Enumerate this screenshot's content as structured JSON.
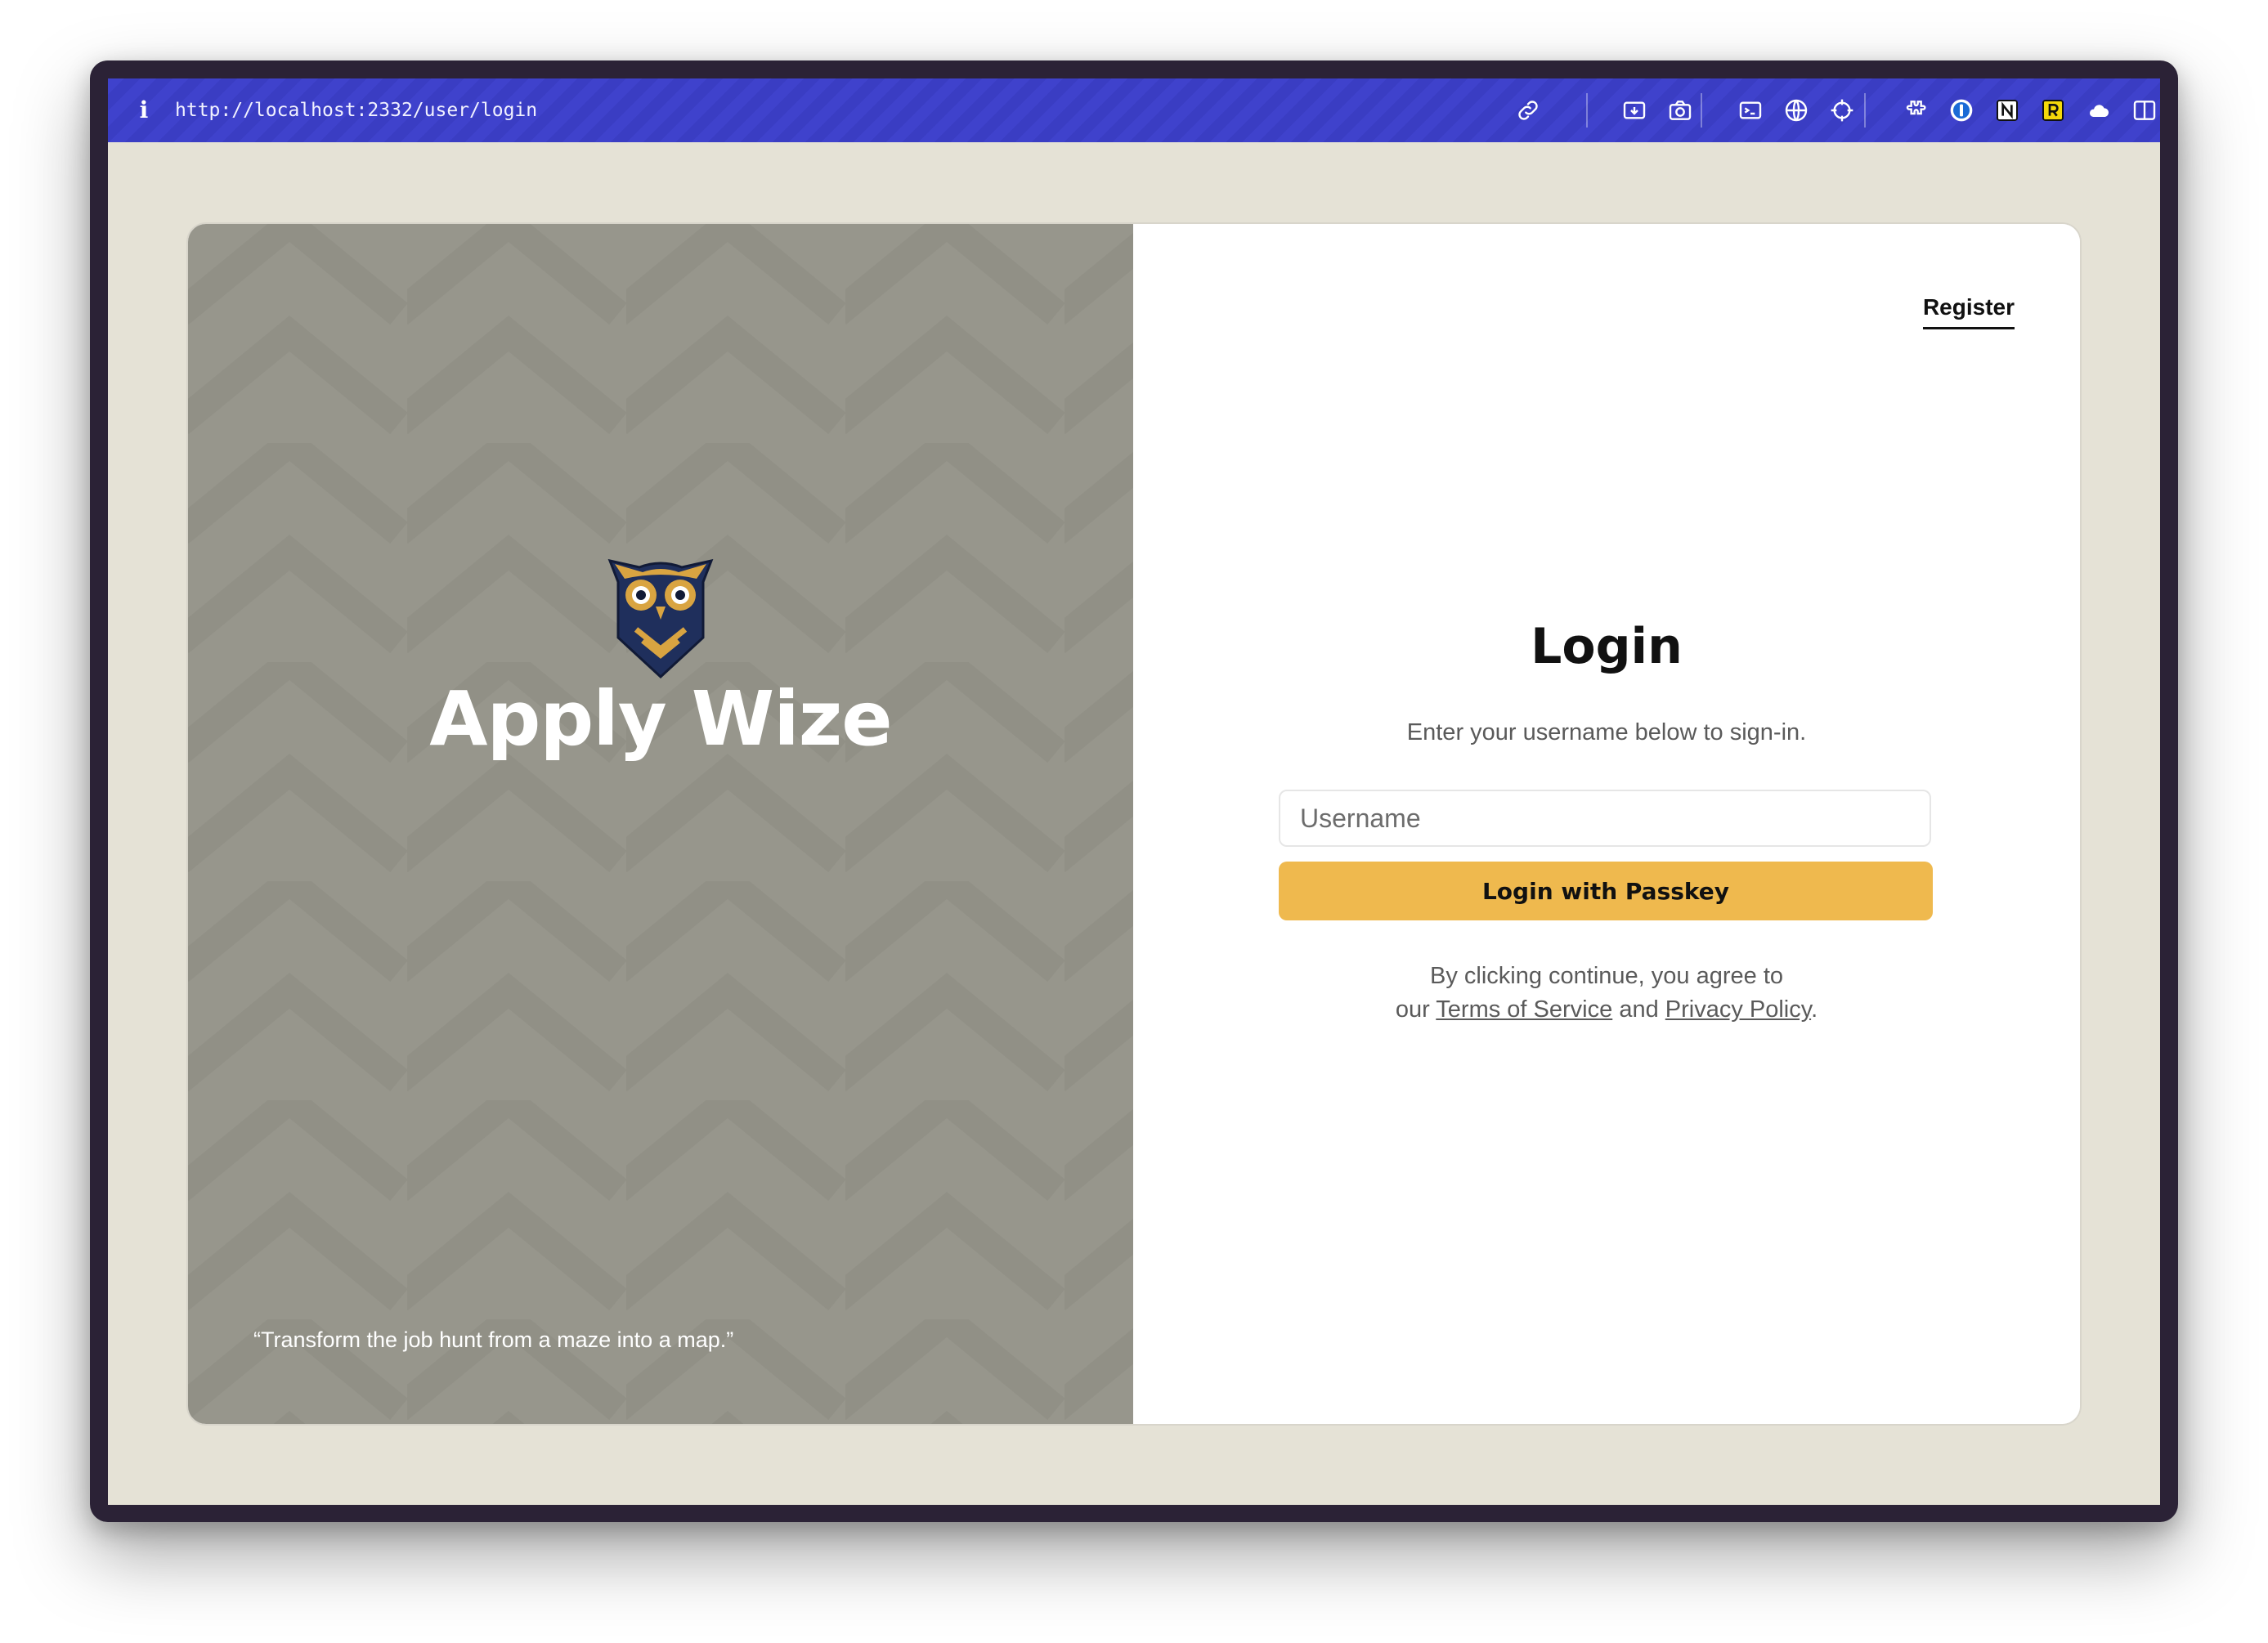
{
  "browser": {
    "url": "http://localhost:2332/user/login",
    "toolbar_icons": [
      "info-icon",
      "link-icon",
      "screenshot-area-icon",
      "camera-icon",
      "terminal-icon",
      "globe-icon",
      "crosshair-icon",
      "puzzle-icon",
      "onepassword-icon",
      "notion-icon",
      "r-extension-icon",
      "cloud-icon",
      "sidebar-icon"
    ]
  },
  "brand": {
    "name": "Apply Wize",
    "tagline": "“Transform the job hunt from a maze into a map.”",
    "logo": "owl-logo"
  },
  "auth": {
    "register_label": "Register",
    "title": "Login",
    "subtitle": "Enter your username below to sign-in.",
    "username_placeholder": "Username",
    "username_value": "",
    "submit_label": "Login with Passkey",
    "terms_line1": "By clicking continue, you agree to",
    "terms_prefix": "our",
    "terms_link": "Terms of Service",
    "terms_and": "and",
    "privacy_link": "Privacy Policy",
    "terms_suffix": "."
  },
  "colors": {
    "toolbar": "#3f42cc",
    "page_bg": "#e5e2d6",
    "left_panel": "#97968c",
    "button": "#efb94e",
    "owl_navy": "#1f2f5c",
    "owl_gold": "#d9a441"
  }
}
